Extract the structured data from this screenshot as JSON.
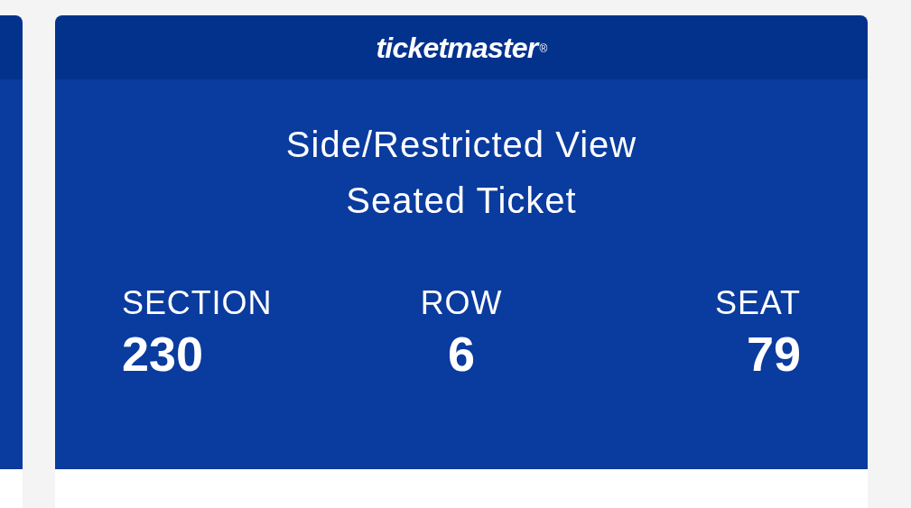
{
  "logo": {
    "text": "ticketmaster",
    "mark": "®"
  },
  "title_lines": [
    "Side/Restricted View",
    "Seated Ticket"
  ],
  "seat_info": [
    {
      "label": "SECTION",
      "value": "230"
    },
    {
      "label": "ROW",
      "value": "6"
    },
    {
      "label": "SEAT",
      "value": "79"
    }
  ]
}
